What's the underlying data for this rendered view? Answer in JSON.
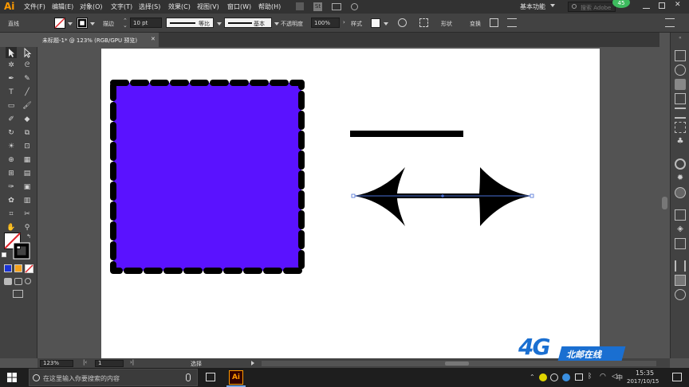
{
  "app": {
    "logo": "Ai",
    "menu": [
      "文件(F)",
      "编辑(E)",
      "对象(O)",
      "文字(T)",
      "选择(S)",
      "效果(C)",
      "视图(V)",
      "窗口(W)",
      "帮助(H)"
    ],
    "workspace": "基本功能",
    "search_placeholder": "搜索 Adobe",
    "notification_count": "45"
  },
  "controlbar": {
    "tool_name": "直线",
    "stroke_label": "描边",
    "stroke_weight": "10 pt",
    "profile_label": "等比",
    "brush_label": "基本",
    "opacity_label": "不透明度",
    "opacity_value": "100%",
    "style_label": "样式",
    "shape_label": "形状",
    "transform_label": "变换"
  },
  "document": {
    "tab_title": "未标题-1* @ 123% (RGB/GPU 预览)",
    "close_glyph": "✕"
  },
  "statusbar": {
    "zoom": "123%",
    "artboard_number": "1",
    "status_text": "选择"
  },
  "taskbar": {
    "search_placeholder": "在这里输入你要搜索的内容",
    "app_icon": "Ai",
    "ime": "中",
    "time": "15:35",
    "date": "2017/10/15"
  },
  "watermark": {
    "text_4g": "4G",
    "text_brand": "北邮在线"
  },
  "colors": {
    "square_fill": "#5a12ff",
    "stroke": "#000000",
    "selection": "#4a6fd6",
    "accent_orange": "#ff9a00",
    "watermark_blue": "#1a6fd1"
  }
}
